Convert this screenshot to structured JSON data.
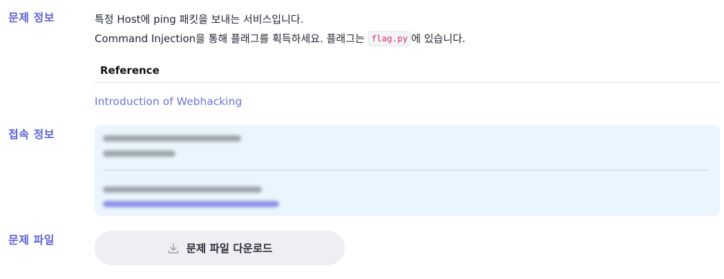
{
  "labels": {
    "problem_info": "문제 정보",
    "connection_info": "접속 정보",
    "problem_file": "문제 파일"
  },
  "description": {
    "line1": "특정 Host에 ping 패킷을 보내는 서비스입니다.",
    "line2_before": "Command Injection을 통해 플래그를 획득하세요. 플래그는 ",
    "line2_code": "flag.py",
    "line2_after": "에 있습니다."
  },
  "reference": {
    "heading": "Reference",
    "link_text": "Introduction of Webhacking"
  },
  "download": {
    "label": "문제 파일 다운로드",
    "icon": "download-icon"
  },
  "colors": {
    "accent": "#5b63d3",
    "link": "#6b74d8",
    "code": "#d6336c",
    "conn_bg": "#eaf5fd",
    "button_bg": "#efeff3"
  }
}
